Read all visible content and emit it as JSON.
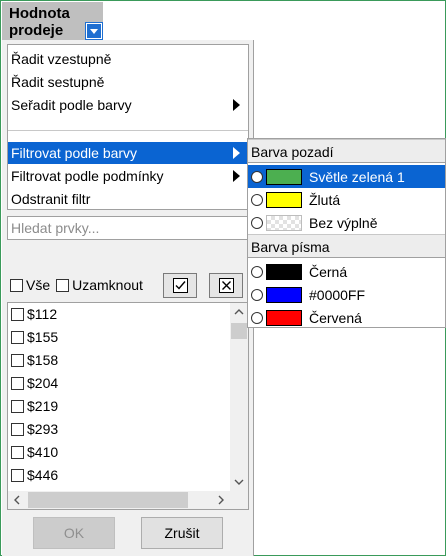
{
  "header": {
    "title_line1": "Hodnota",
    "title_line2": "prodeje",
    "dropdown_icon": "filter-dropdown-icon"
  },
  "menu": {
    "items": [
      {
        "label": "Řadit vzestupně",
        "submenu": false
      },
      {
        "label": "Řadit sestupně",
        "submenu": false
      },
      {
        "label": "Seřadit podle barvy",
        "submenu": true
      },
      {
        "label": "Filtrovat podle barvy",
        "submenu": true,
        "highlighted": true
      },
      {
        "label": "Filtrovat podle podmínky",
        "submenu": true
      },
      {
        "label": "Odstranit filtr",
        "submenu": false
      }
    ]
  },
  "search": {
    "placeholder": "Hledat prvky...",
    "value": ""
  },
  "options": {
    "select_all_label": "Vše",
    "lock_label": "Uzamknout"
  },
  "values": [
    "$112",
    "$155",
    "$158",
    "$204",
    "$219",
    "$293",
    "$410",
    "$446"
  ],
  "buttons": {
    "ok_label": "OK",
    "cancel_label": "Zrušit",
    "ok_disabled": true
  },
  "color_submenu": {
    "background_header": "Barva pozadí",
    "background_items": [
      {
        "label": "Světle zelená 1",
        "color": "#4caf50",
        "highlighted": true
      },
      {
        "label": "Žlutá",
        "color": "#ffff00"
      },
      {
        "label": "Bez výplně",
        "color": "none"
      }
    ],
    "font_header": "Barva písma",
    "font_items": [
      {
        "label": "Černá",
        "color": "#000000"
      },
      {
        "label": "#0000FF",
        "color": "#0000ff"
      },
      {
        "label": "Červená",
        "color": "#ff0000"
      }
    ]
  },
  "colors": {
    "accent": "#0a64d2",
    "header_bg": "#bfbfbf",
    "frame": "#3a9a5a"
  }
}
